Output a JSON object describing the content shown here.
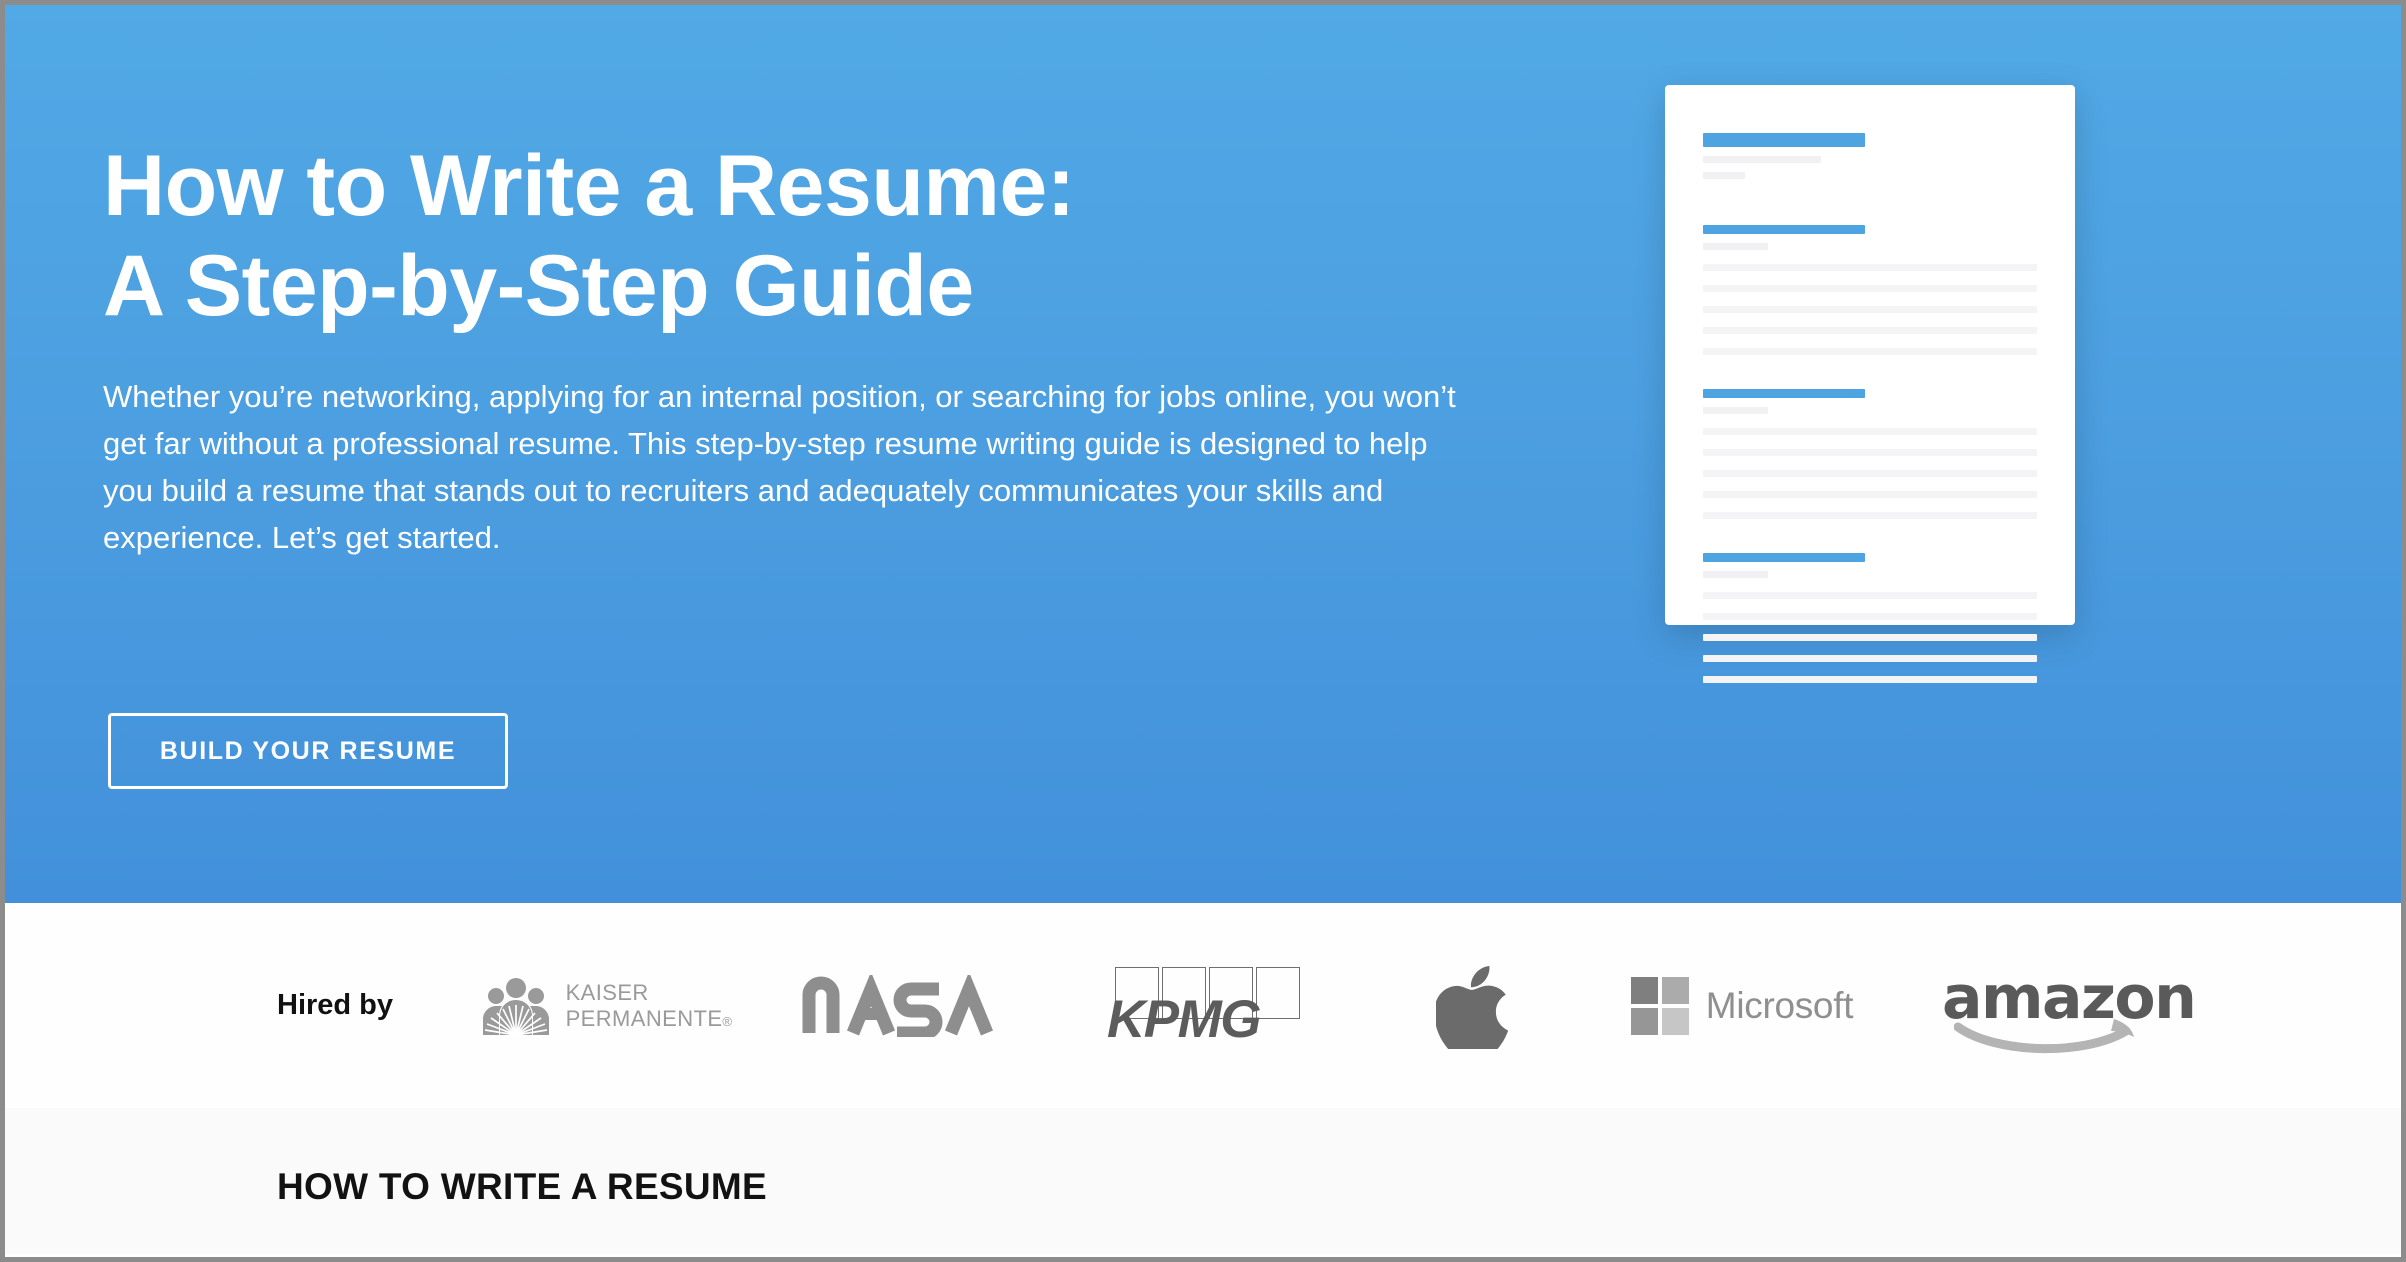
{
  "hero": {
    "title": "How to Write a Resume:\nA Step-by-Step Guide",
    "subtitle": "Whether you’re networking, applying for an internal position, or searching for jobs online, you won’t get far without a professional resume. This step-by-step resume writing guide is designed to help you build a resume that stands out to recruiters and adequately communicates your skills and experience. Let’s get started.",
    "cta_label": "BUILD YOUR RESUME",
    "bg_color_top": "#51a9e5",
    "bg_color_bottom": "#4290db"
  },
  "resume_preview": {
    "accent_color": "#4da4e0",
    "placeholder_color": "#f4f4f7",
    "sections": 4
  },
  "logo_strip": {
    "label": "Hired by",
    "logos": [
      {
        "name": "kaiser-permanente-logo",
        "text": "KAISER\nPERMANENTE",
        "registered": "®"
      },
      {
        "name": "nasa-logo",
        "text": "NASA"
      },
      {
        "name": "kpmg-logo",
        "text": "KPMG"
      },
      {
        "name": "apple-logo",
        "text": ""
      },
      {
        "name": "microsoft-logo",
        "text": "Microsoft"
      },
      {
        "name": "amazon-logo",
        "text": "amazon"
      }
    ]
  },
  "bottom_section": {
    "heading": "HOW TO WRITE A RESUME"
  }
}
